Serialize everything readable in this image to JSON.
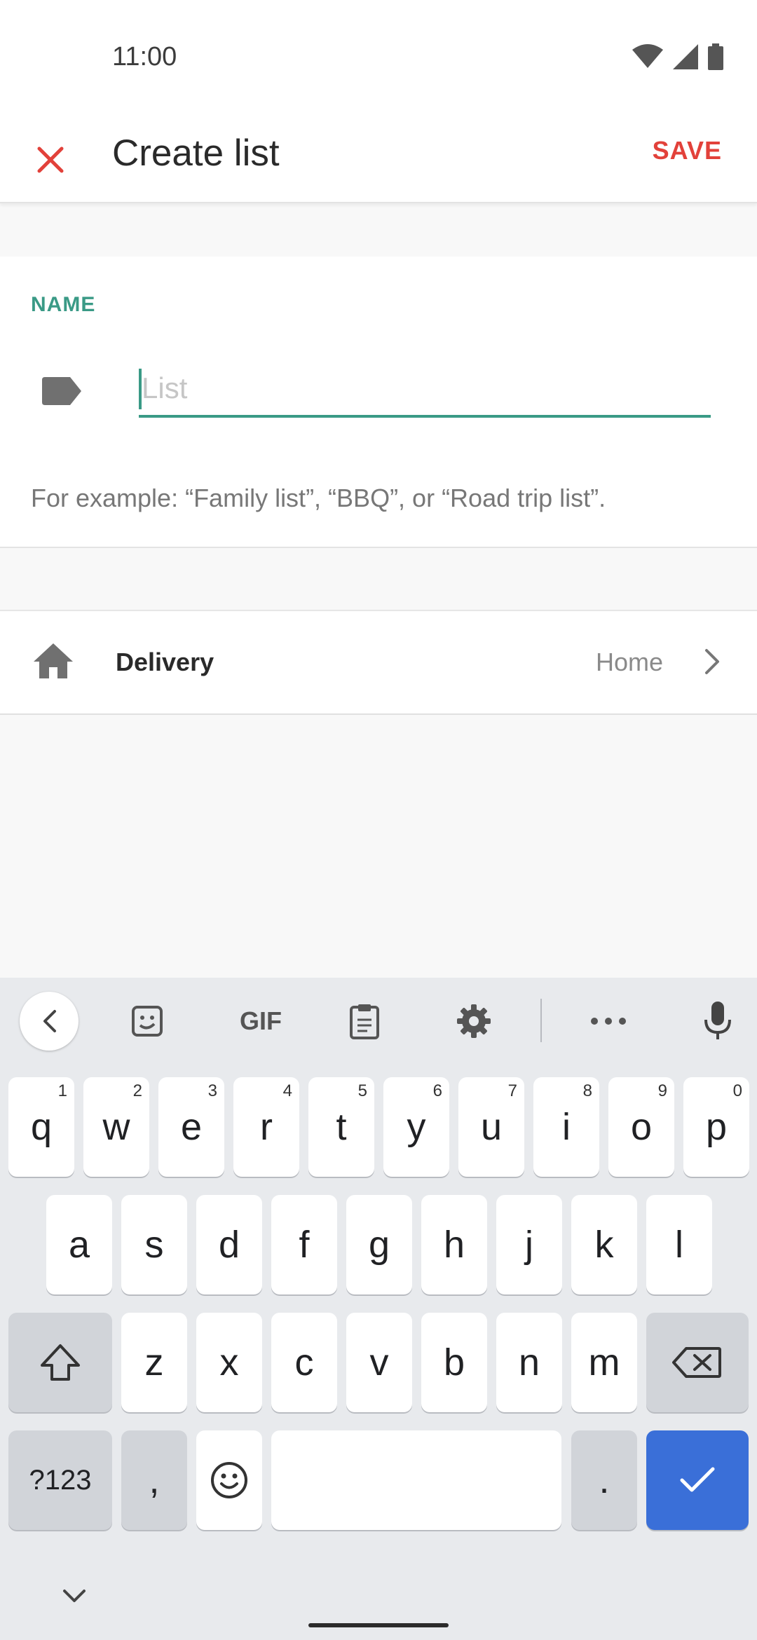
{
  "status_bar": {
    "time": "11:00"
  },
  "app_bar": {
    "title": "Create list",
    "save_label": "SAVE"
  },
  "name_section": {
    "label": "NAME",
    "input_value": "",
    "input_placeholder": "List",
    "example_text": "For example: “Family list”, “BBQ”, or “Road trip list”."
  },
  "delivery": {
    "label": "Delivery",
    "value": "Home"
  },
  "keyboard": {
    "toolbar": [
      "back-icon",
      "sticker-icon",
      "gif-icon",
      "clipboard-icon",
      "settings-icon",
      "more-icon",
      "mic-icon"
    ],
    "gif_label": "GIF",
    "row1": [
      {
        "key": "q",
        "hint": "1"
      },
      {
        "key": "w",
        "hint": "2"
      },
      {
        "key": "e",
        "hint": "3"
      },
      {
        "key": "r",
        "hint": "4"
      },
      {
        "key": "t",
        "hint": "5"
      },
      {
        "key": "y",
        "hint": "6"
      },
      {
        "key": "u",
        "hint": "7"
      },
      {
        "key": "i",
        "hint": "8"
      },
      {
        "key": "o",
        "hint": "9"
      },
      {
        "key": "p",
        "hint": "0"
      }
    ],
    "row2": [
      "a",
      "s",
      "d",
      "f",
      "g",
      "h",
      "j",
      "k",
      "l"
    ],
    "row3": [
      "z",
      "x",
      "c",
      "v",
      "b",
      "n",
      "m"
    ],
    "symbols_label": "?123",
    "comma": ",",
    "period": "."
  },
  "colors": {
    "accent": "#3a9a86",
    "save": "#e2413a",
    "action_key": "#3a6fd8"
  }
}
